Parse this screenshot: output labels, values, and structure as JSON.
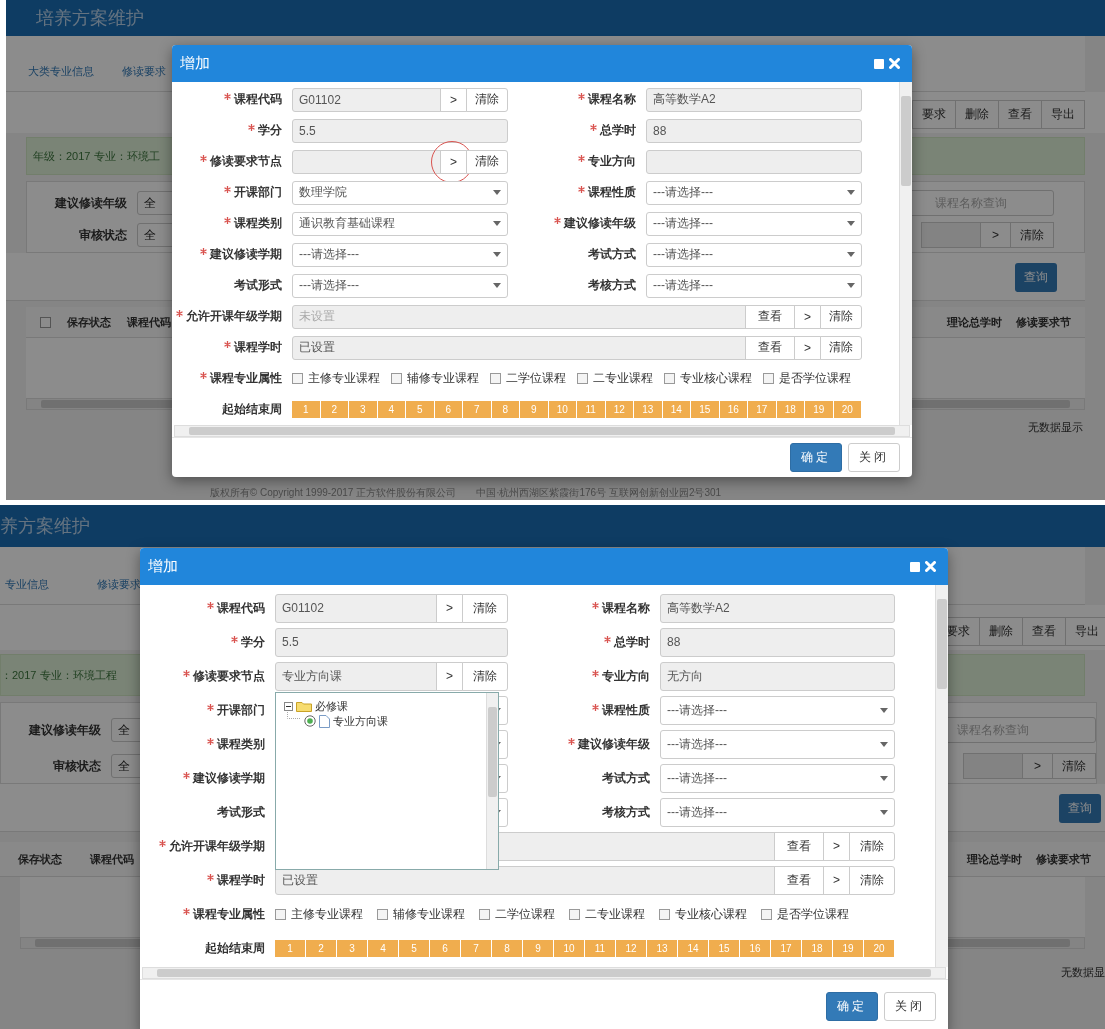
{
  "panels": [
    {
      "app_title": "培养方案维护",
      "nav_tabs": [
        "大类专业信息",
        "修读要求"
      ],
      "toolbar_buttons": [
        "要求",
        "删除",
        "查看",
        "导出"
      ],
      "info_text": "年级：2017 专业：环境工",
      "filters": [
        {
          "label": "建议修读年级",
          "value": "全"
        },
        {
          "label": "审核状态",
          "value": "全"
        }
      ],
      "search": {
        "placeholder": "课程名称查询"
      },
      "picker_buttons": [
        {
          "label": ">",
          "kind": "browse"
        },
        {
          "label": "清除",
          "kind": "clear"
        }
      ],
      "query_button": "查询",
      "table": {
        "select_all": {
          "checked": false
        },
        "columns_left": [
          "保存状态",
          "课程代码"
        ],
        "columns_right": [
          "理论总学时",
          "修读要求节"
        ],
        "empty_text": "无数据显示"
      },
      "footer": "版权所有© Copyright 1999-2017 正方软件股份有限公司　　中国·杭州西湖区紫霞街176号 互联网创新创业园2号301",
      "dialog": {
        "title": "增加",
        "fields": [
          {
            "label": "课程代码",
            "required": true,
            "kind": "picker",
            "value": "G01102",
            "buttons": [
              {
                "label": ">",
                "kind": "browse"
              },
              {
                "label": "清除",
                "kind": "clear"
              }
            ]
          },
          {
            "label": "课程名称",
            "required": true,
            "kind": "text",
            "value": "高等数学A2"
          },
          {
            "label": "学分",
            "required": true,
            "kind": "text",
            "value": "5.5"
          },
          {
            "label": "总学时",
            "required": true,
            "kind": "text",
            "value": "88"
          },
          {
            "label": "修读要求节点",
            "required": true,
            "kind": "picker",
            "circled": true,
            "buttons": [
              {
                "label": ">",
                "kind": "browse"
              },
              {
                "label": "清除",
                "kind": "clear"
              }
            ]
          },
          {
            "label": "专业方向",
            "required": true,
            "kind": "text"
          },
          {
            "label": "开课部门",
            "required": true,
            "kind": "select",
            "value": "数理学院"
          },
          {
            "label": "课程性质",
            "required": true,
            "kind": "select",
            "value": "---请选择---"
          },
          {
            "label": "课程类别",
            "required": true,
            "kind": "select",
            "value": "通识教育基础课程"
          },
          {
            "label": "建议修读年级",
            "required": true,
            "kind": "select",
            "value": "---请选择---"
          },
          {
            "label": "建议修读学期",
            "required": true,
            "kind": "select",
            "value": "---请选择---"
          },
          {
            "label": "考试方式",
            "required": false,
            "kind": "select",
            "value": "---请选择---"
          },
          {
            "label": "考试形式",
            "required": false,
            "kind": "select",
            "value": "---请选择---"
          },
          {
            "label": "考核方式",
            "required": false,
            "kind": "select",
            "value": "---请选择---"
          },
          {
            "label": "允许开课年级学期",
            "required": true,
            "kind": "long_picker",
            "placeholder": "未设置",
            "buttons": [
              {
                "label": "查看",
                "kind": "view"
              },
              {
                "label": ">",
                "kind": "browse"
              },
              {
                "label": "清除",
                "kind": "clear"
              }
            ]
          },
          {
            "label": "课程学时",
            "required": true,
            "kind": "long_picker",
            "value": "已设置",
            "buttons": [
              {
                "label": "查看",
                "kind": "view"
              },
              {
                "label": ">",
                "kind": "browse"
              },
              {
                "label": "清除",
                "kind": "clear"
              }
            ]
          },
          {
            "label": "课程专业属性",
            "required": true,
            "kind": "checkboxes",
            "options": [
              {
                "label": "主修专业课程",
                "checked": false
              },
              {
                "label": "辅修专业课程",
                "checked": false
              },
              {
                "label": "二学位课程",
                "checked": false
              },
              {
                "label": "二专业课程",
                "checked": false
              },
              {
                "label": "专业核心课程",
                "checked": false
              },
              {
                "label": "是否学位课程",
                "checked": false
              }
            ]
          },
          {
            "label": "起始结束周",
            "required": false,
            "kind": "weeks",
            "weeks": [
              "1",
              "2",
              "3",
              "4",
              "5",
              "6",
              "7",
              "8",
              "9",
              "10",
              "11",
              "12",
              "13",
              "14",
              "15",
              "16",
              "17",
              "18",
              "19",
              "20"
            ]
          }
        ],
        "actions": [
          {
            "label": "确定",
            "primary": true
          },
          {
            "label": "关闭",
            "primary": false
          }
        ]
      }
    },
    {
      "app_title": "养方案维护",
      "nav_tabs": [
        "专业信息",
        "修读要求"
      ],
      "toolbar_buttons": [
        "要求",
        "删除",
        "查看",
        "导出"
      ],
      "info_text": "：2017 专业：环境工程",
      "filters": [
        {
          "label": "建议修读年级",
          "value": "全"
        },
        {
          "label": "审核状态",
          "value": "全"
        }
      ],
      "search": {
        "placeholder": "课程名称查询"
      },
      "picker_buttons": [
        {
          "label": ">",
          "kind": "browse"
        },
        {
          "label": "清除",
          "kind": "clear"
        }
      ],
      "query_button": "查询",
      "table": {
        "columns_left": [
          "保存状态",
          "课程代码"
        ],
        "columns_right": [
          "理论总学时",
          "修读要求节"
        ],
        "empty_text": "无数据显"
      },
      "dialog": {
        "title": "增加",
        "fields": [
          {
            "label": "课程代码",
            "required": true,
            "kind": "picker",
            "value": "G01102",
            "buttons": [
              {
                "label": ">",
                "kind": "browse"
              },
              {
                "label": "清除",
                "kind": "clear"
              }
            ]
          },
          {
            "label": "课程名称",
            "required": true,
            "kind": "text",
            "value": "高等数学A2"
          },
          {
            "label": "学分",
            "required": true,
            "kind": "text",
            "value": "5.5"
          },
          {
            "label": "总学时",
            "required": true,
            "kind": "text",
            "value": "88"
          },
          {
            "label": "修读要求节点",
            "required": true,
            "kind": "picker",
            "value": "专业方向课",
            "buttons": [
              {
                "label": ">",
                "kind": "browse"
              },
              {
                "label": "清除",
                "kind": "clear"
              }
            ],
            "dropdown": [
              {
                "label": "必修课",
                "expanded": true,
                "children": [
                  {
                    "label": "专业方向课",
                    "selected": true
                  }
                ]
              }
            ]
          },
          {
            "label": "专业方向",
            "required": true,
            "kind": "text",
            "value": "无方向"
          },
          {
            "label": "开课部门",
            "required": true,
            "kind": "select"
          },
          {
            "label": "课程性质",
            "required": true,
            "kind": "select",
            "value": "---请选择---"
          },
          {
            "label": "课程类别",
            "required": true,
            "kind": "select"
          },
          {
            "label": "建议修读年级",
            "required": true,
            "kind": "select",
            "value": "---请选择---"
          },
          {
            "label": "建议修读学期",
            "required": true,
            "kind": "select"
          },
          {
            "label": "考试方式",
            "required": false,
            "kind": "select",
            "value": "---请选择---"
          },
          {
            "label": "考试形式",
            "required": false,
            "kind": "select"
          },
          {
            "label": "考核方式",
            "required": false,
            "kind": "select",
            "value": "---请选择---"
          },
          {
            "label": "允许开课年级学期",
            "required": true,
            "kind": "long_picker",
            "buttons": [
              {
                "label": "查看",
                "kind": "view"
              },
              {
                "label": ">",
                "kind": "browse"
              },
              {
                "label": "清除",
                "kind": "clear"
              }
            ]
          },
          {
            "label": "课程学时",
            "required": true,
            "kind": "long_picker",
            "value": "已设置",
            "buttons": [
              {
                "label": "查看",
                "kind": "view"
              },
              {
                "label": ">",
                "kind": "browse"
              },
              {
                "label": "清除",
                "kind": "clear"
              }
            ]
          },
          {
            "label": "课程专业属性",
            "required": true,
            "kind": "checkboxes",
            "options": [
              {
                "label": "主修专业课程",
                "checked": false
              },
              {
                "label": "辅修专业课程",
                "checked": false
              },
              {
                "label": "二学位课程",
                "checked": false
              },
              {
                "label": "二专业课程",
                "checked": false
              },
              {
                "label": "专业核心课程",
                "checked": false
              },
              {
                "label": "是否学位课程",
                "checked": false
              }
            ]
          },
          {
            "label": "起始结束周",
            "required": false,
            "kind": "weeks",
            "weeks": [
              "1",
              "2",
              "3",
              "4",
              "5",
              "6",
              "7",
              "8",
              "9",
              "10",
              "11",
              "12",
              "13",
              "14",
              "15",
              "16",
              "17",
              "18",
              "19",
              "20"
            ]
          }
        ],
        "actions": [
          {
            "label": "确定",
            "primary": true
          },
          {
            "label": "关闭",
            "primary": false
          }
        ]
      }
    }
  ]
}
